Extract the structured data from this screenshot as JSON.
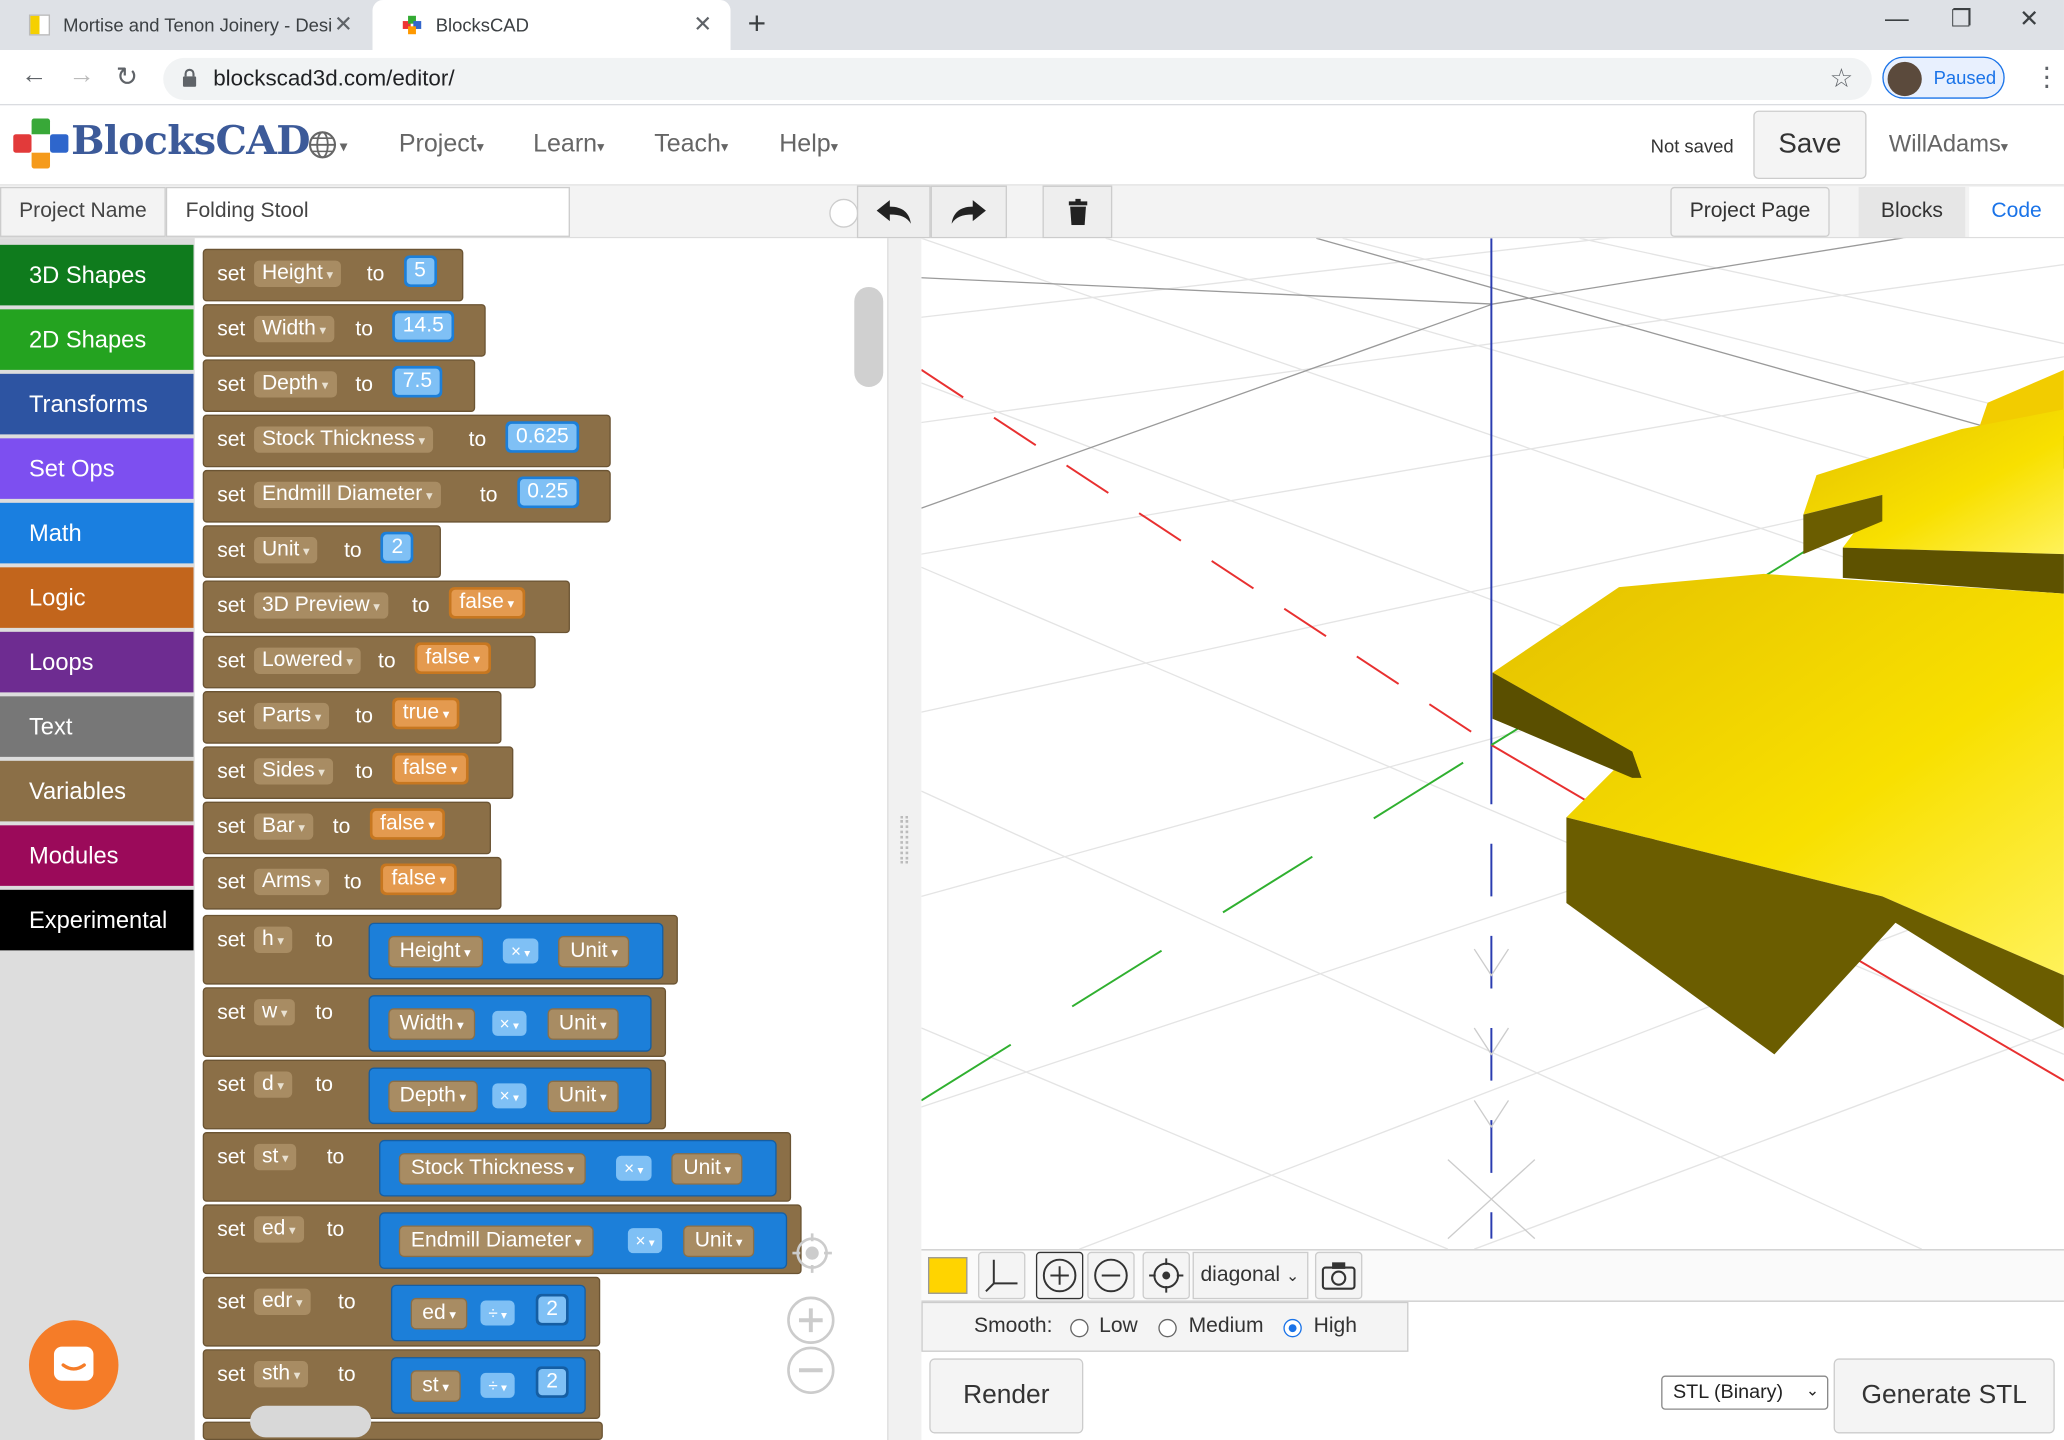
{
  "browser": {
    "tabs": [
      {
        "title": "Mortise and Tenon Joinery - Desi",
        "active": false
      },
      {
        "title": "BlocksCAD",
        "active": true
      }
    ],
    "url": "blockscad3d.com/editor/",
    "profile_label": "Paused"
  },
  "app": {
    "logo": "BlocksCAD",
    "nav": [
      "Project",
      "Learn",
      "Teach",
      "Help"
    ],
    "save_status": "Not saved",
    "save_label": "Save",
    "user": "WillAdams"
  },
  "project": {
    "name_label": "Project Name",
    "name_value": "Folding Stool",
    "project_page_label": "Project Page",
    "view_tabs": [
      "Blocks",
      "Code"
    ],
    "active_view": "Blocks"
  },
  "categories": [
    {
      "label": "3D Shapes",
      "color": "#0f7b1d"
    },
    {
      "label": "2D Shapes",
      "color": "#24a320"
    },
    {
      "label": "Transforms",
      "color": "#2d54a2"
    },
    {
      "label": "Set Ops",
      "color": "#7d4ff0"
    },
    {
      "label": "Math",
      "color": "#1a7fe0"
    },
    {
      "label": "Logic",
      "color": "#c2651c"
    },
    {
      "label": "Loops",
      "color": "#6e2c91"
    },
    {
      "label": "Text",
      "color": "#777777"
    },
    {
      "label": "Variables",
      "color": "#8b6f47"
    },
    {
      "label": "Modules",
      "color": "#9b0a5a"
    },
    {
      "label": "Experimental",
      "color": "#000000"
    }
  ],
  "blocks": {
    "set_word": "set",
    "to_word": "to",
    "simple": [
      {
        "var": "Height",
        "value": "5",
        "kind": "num"
      },
      {
        "var": "Width",
        "value": "14.5",
        "kind": "num"
      },
      {
        "var": "Depth",
        "value": "7.5",
        "kind": "num"
      },
      {
        "var": "Stock Thickness",
        "value": "0.625",
        "kind": "num"
      },
      {
        "var": "Endmill Diameter",
        "value": "0.25",
        "kind": "num"
      },
      {
        "var": "Unit",
        "value": "2",
        "kind": "num"
      },
      {
        "var": "3D Preview",
        "value": "false",
        "kind": "bool"
      },
      {
        "var": "Lowered",
        "value": "false",
        "kind": "bool"
      },
      {
        "var": "Parts",
        "value": "true",
        "kind": "bool"
      },
      {
        "var": "Sides",
        "value": "false",
        "kind": "bool"
      },
      {
        "var": "Bar",
        "value": "false",
        "kind": "bool"
      },
      {
        "var": "Arms",
        "value": "false",
        "kind": "bool"
      }
    ],
    "math": [
      {
        "var": "h",
        "a": "Height",
        "op": "×",
        "b": "Unit"
      },
      {
        "var": "w",
        "a": "Width",
        "op": "×",
        "b": "Unit"
      },
      {
        "var": "d",
        "a": "Depth",
        "op": "×",
        "b": "Unit"
      },
      {
        "var": "st",
        "a": "Stock Thickness",
        "op": "×",
        "b": "Unit"
      },
      {
        "var": "ed",
        "a": "Endmill Diameter",
        "op": "×",
        "b": "Unit"
      },
      {
        "var": "edr",
        "a": "ed",
        "op": "÷",
        "b": "2"
      },
      {
        "var": "sth",
        "a": "st",
        "op": "÷",
        "b": "2"
      }
    ]
  },
  "viewer": {
    "view_select": "diagonal",
    "color_swatch": "#ffd400",
    "smooth_label": "Smooth:",
    "smooth_options": [
      "Low",
      "Medium",
      "High"
    ],
    "smooth_selected": "High",
    "render_label": "Render",
    "format": "STL (Binary)",
    "generate_label": "Generate STL",
    "model_color": "#f0c800"
  }
}
